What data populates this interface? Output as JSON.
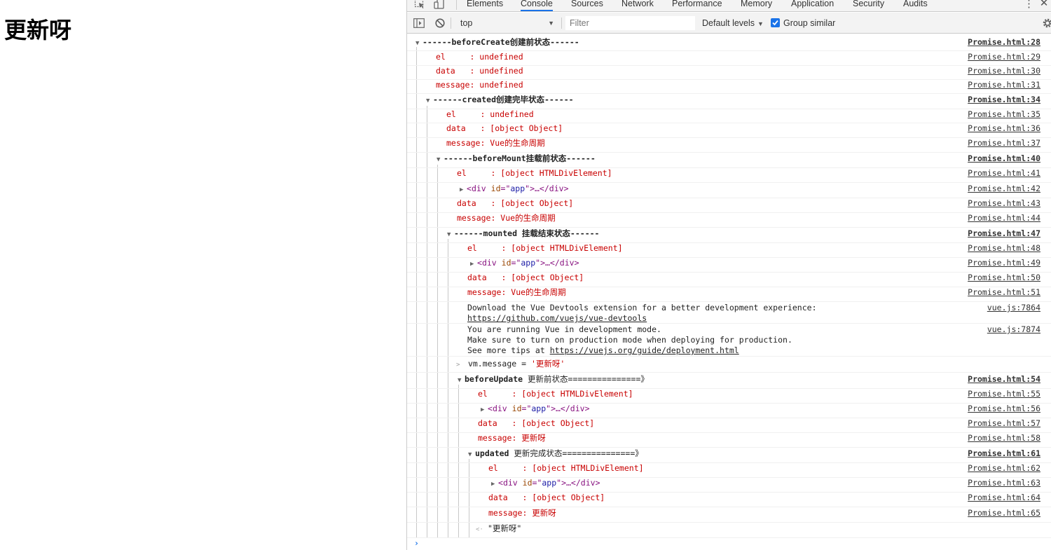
{
  "page": {
    "heading": "更新呀"
  },
  "devtools": {
    "tabs": [
      "Elements",
      "Console",
      "Sources",
      "Network",
      "Performance",
      "Memory",
      "Application",
      "Security",
      "Audits"
    ],
    "active_tab": "Console",
    "toolbar": {
      "context": "top",
      "filter_placeholder": "Filter",
      "levels": "Default levels",
      "group_similar": "Group similar",
      "group_similar_checked": true
    },
    "colors": {
      "accent": "#1a73e8",
      "log_red": "#c80000"
    },
    "console": [
      {
        "text": "------beforeCreate创建前状态------",
        "src": "Promise.html:28"
      },
      {
        "text": "el     : undefined",
        "src": "Promise.html:29"
      },
      {
        "text": "data   : undefined",
        "src": "Promise.html:30"
      },
      {
        "text": "message: undefined",
        "src": "Promise.html:31"
      },
      {
        "text": "------created创建完毕状态------",
        "src": "Promise.html:34"
      },
      {
        "text": "el     : undefined",
        "src": "Promise.html:35"
      },
      {
        "text": "data   : [object Object]",
        "src": "Promise.html:36"
      },
      {
        "text": "message: Vue的生命周期",
        "src": "Promise.html:37"
      },
      {
        "text": "------beforeMount挂载前状态------",
        "src": "Promise.html:40"
      },
      {
        "text": "el     : [object HTMLDivElement]",
        "src": "Promise.html:41"
      },
      {
        "el_tag": "div",
        "el_attr": "id",
        "el_val": "app",
        "src": "Promise.html:42"
      },
      {
        "text": "data   : [object Object]",
        "src": "Promise.html:43"
      },
      {
        "text": "message: Vue的生命周期",
        "src": "Promise.html:44"
      },
      {
        "text": "------mounted 挂载结束状态------",
        "src": "Promise.html:47"
      },
      {
        "text": "el     : [object HTMLDivElement]",
        "src": "Promise.html:48"
      },
      {
        "el_tag": "div",
        "el_attr": "id",
        "el_val": "app",
        "src": "Promise.html:49"
      },
      {
        "text": "data   : [object Object]",
        "src": "Promise.html:50"
      },
      {
        "text": "message: Vue的生命周期",
        "src": "Promise.html:51"
      },
      {
        "text": "Download the Vue Devtools extension for a better development experience:",
        "link": "https://github.com/vuejs/vue-devtools",
        "src": "vue.js:7864"
      },
      {
        "text": "You are running Vue in development mode.",
        "text2": "Make sure to turn on production mode when deploying for production.",
        "text3_prefix": "See more tips at ",
        "link": "https://vuejs.org/guide/deployment.html",
        "src": "vue.js:7874"
      },
      {
        "text_prefix": "vm.message = ",
        "text_str": "'更新呀'"
      },
      {
        "text_bold": "beforeUpdate",
        "text": " 更新前状态===============》",
        "src": "Promise.html:54"
      },
      {
        "text": "el     : [object HTMLDivElement]",
        "src": "Promise.html:55"
      },
      {
        "el_tag": "div",
        "el_attr": "id",
        "el_val": "app",
        "src": "Promise.html:56"
      },
      {
        "text": "data   : [object Object]",
        "src": "Promise.html:57"
      },
      {
        "text": "message: 更新呀",
        "src": "Promise.html:58"
      },
      {
        "text_bold": "updated",
        "text": " 更新完成状态===============》",
        "src": "Promise.html:61"
      },
      {
        "text": "el     : [object HTMLDivElement]",
        "src": "Promise.html:62"
      },
      {
        "el_tag": "div",
        "el_attr": "id",
        "el_val": "app",
        "src": "Promise.html:63"
      },
      {
        "text": "data   : [object Object]",
        "src": "Promise.html:64"
      },
      {
        "text": "message: 更新呀",
        "src": "Promise.html:65"
      },
      {
        "text": "\"更新呀\""
      }
    ]
  }
}
